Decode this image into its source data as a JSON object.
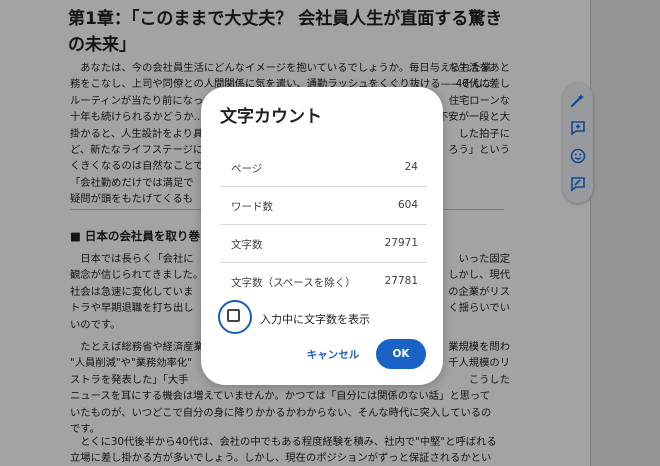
{
  "document": {
    "title_lines": [
      "第1章：「このままで大丈夫？ 会社員人生が直面する驚き",
      "の未来」"
    ],
    "paragraph1": [
      "　あなたは、今の会社員生活にどんなイメージを抱いているでしょうか。毎日与えられた業",
      "務をこなし、上司や同僚との人間関係に気を遣い、通勤ラッシュをくぐり抜ける——そんな",
      "ルーティンが当たり前になっ",
      "十年も続けられるかどうか…」と",
      "掛かると、人生設計をより具",
      "ど、新たなライフステージに",
      "くきくなるのは自然なことで",
      "「会社勤めだけでは満足で",
      "疑問が頭をもたげてくるも"
    ],
    "paragraph1_right": [
      "",
      "",
      "な生活をあと",
      "40代に差し",
      "住宅ローンな",
      "不安が一段と大",
      "した拍子に",
      "ろう」という",
      ""
    ],
    "heading": "■ 日本の会社員を取り巻",
    "paragraph2": [
      "　日本では長らく「会社に",
      "観念が信じられてきました。",
      "社会は急速に変化していま",
      "トラや早期退職を打ち出し",
      "いのです。"
    ],
    "paragraph2_right": [
      "いった固定",
      "しかし、現代",
      "の企業がリス",
      "く揺らいでい",
      ""
    ],
    "paragraph3": [
      "　たとえば総務省や経済産業",
      "\"人員削減\"や\"業務効率化\"",
      "ストラを発表した」「大手",
      "ニュースを耳にする機会は増えていませんか。かつては「自分には関係のない話」と思って",
      "いたものが、いつどこで自分の身に降りかかるかわからない、そんな時代に突入しているの",
      "です。"
    ],
    "paragraph3_right": [
      "業規模を問わ",
      "千人規模のリ",
      "こうした",
      "",
      "",
      ""
    ],
    "paragraph4": [
      "　とくに30代後半から40代は、会社の中でもある程度経験を積み、社内で\"中堅\"と呼ばれる",
      "立場に差し掛かる方が多いでしょう。しかし、現在のポジションがずっと保証されるかとい"
    ]
  },
  "side_toolbar": {
    "icons": [
      "magic-pen-icon",
      "add-comment-icon",
      "emoji-icon",
      "suggest-edit-icon"
    ]
  },
  "dialog": {
    "title": "文字カウント",
    "stats": [
      {
        "label": "ページ",
        "value": "24"
      },
      {
        "label": "ワード数",
        "value": "604"
      },
      {
        "label": "文字数",
        "value": "27971"
      },
      {
        "label": "文字数（スペースを除く）",
        "value": "27781"
      }
    ],
    "checkbox_label": "入力中に文字数を表示",
    "checkbox_checked": false,
    "cancel_label": "キャンセル",
    "ok_label": "OK"
  },
  "colors": {
    "accent": "#1a62c6",
    "scrim": "rgba(0,0,0,0.36)"
  }
}
